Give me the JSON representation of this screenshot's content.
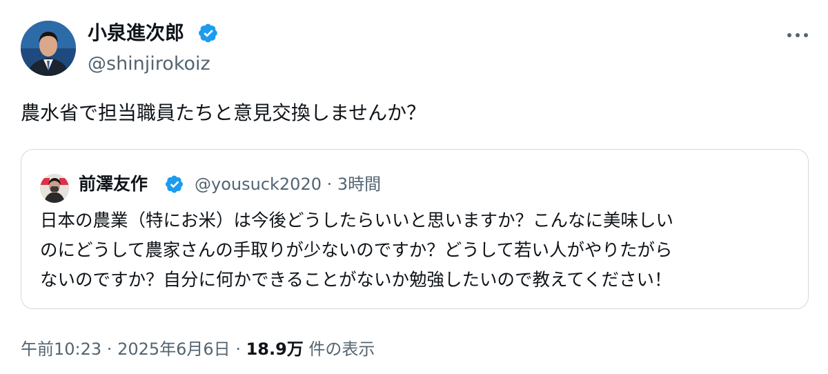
{
  "author": {
    "name": "小泉進次郎",
    "handle": "@shinjirokoiz",
    "verified": true
  },
  "tweet": {
    "text": "農水省で担当職員たちと意見交換しませんか？"
  },
  "quoted_tweet": {
    "author_name": "前澤友作",
    "author_handle": "@yousuck2020",
    "separator": " · ",
    "time_ago": "3時間",
    "verified": true,
    "text_lines": [
      "日本の農業（特にお米）は今後どうしたらいいと思いますか？こんなに美味しい",
      "のにどうして農家さんの手取りが少ないのですか？どうして若い人がやりたがら",
      "ないのですか？自分に何かできることがないか勉強したいので教えてください！"
    ]
  },
  "footer": {
    "time": "午前10:23",
    "separator": " · ",
    "date": "2025年6月6日",
    "views_count": "18.9万",
    "views_label": " 件の表示"
  },
  "colors": {
    "verified_badge": "#1d9bf0",
    "secondary_text": "#536471",
    "primary_text": "#0f1419",
    "border": "#cfd9de"
  },
  "icons": {
    "verified": "verified-badge-icon",
    "more": "more-options-icon"
  }
}
